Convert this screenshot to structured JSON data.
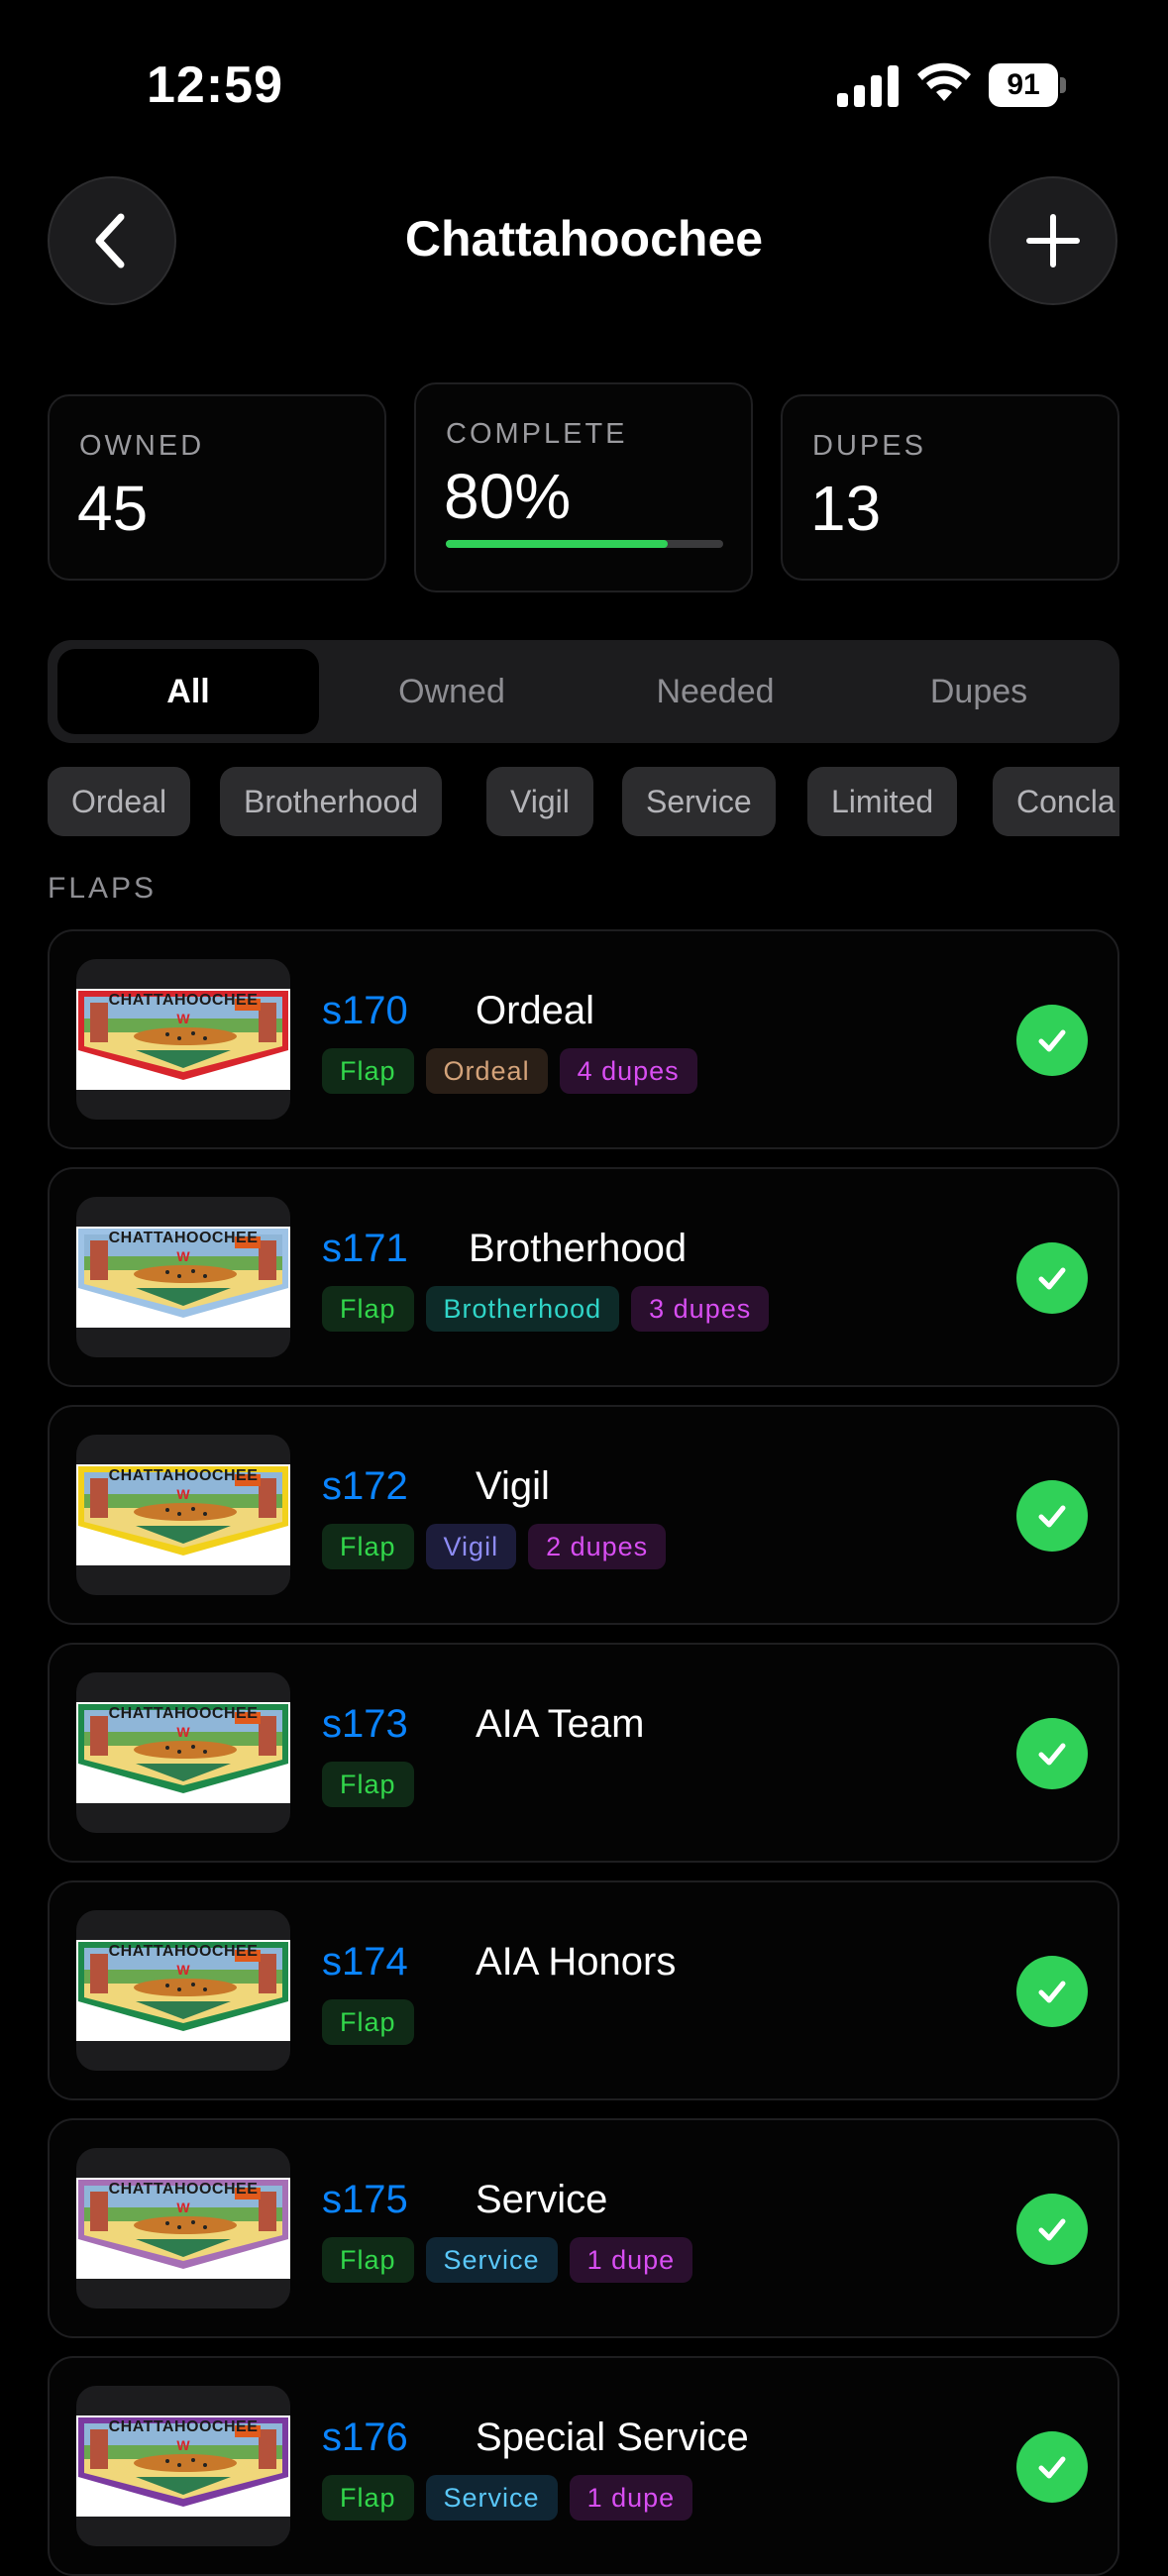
{
  "status": {
    "time": "12:59",
    "battery": "91"
  },
  "header": {
    "title": "Chattahoochee"
  },
  "stats": {
    "owned": {
      "label": "OWNED",
      "value": "45"
    },
    "complete": {
      "label": "COMPLETE",
      "value": "80%",
      "progress": 0.8
    },
    "dupes": {
      "label": "DUPES",
      "value": "13"
    }
  },
  "segments": [
    "All",
    "Owned",
    "Needed",
    "Dupes"
  ],
  "active_segment": "All",
  "filters": [
    "Ordeal",
    "Brotherhood",
    "Vigil",
    "Service",
    "Limited",
    "Concla"
  ],
  "section": "FLAPS",
  "items": [
    {
      "code": "s170",
      "name": "Ordeal",
      "tags": [
        {
          "text": "Flap",
          "kind": "flap"
        },
        {
          "text": "Ordeal",
          "kind": "ordeal"
        },
        {
          "text": "4 dupes",
          "kind": "dupes"
        }
      ],
      "border_color": "#d8252c"
    },
    {
      "code": "s171",
      "name": "Brotherhood",
      "tags": [
        {
          "text": "Flap",
          "kind": "flap"
        },
        {
          "text": "Brotherhood",
          "kind": "brotherhood"
        },
        {
          "text": "3 dupes",
          "kind": "dupes"
        }
      ],
      "border_color": "#9ec3e6"
    },
    {
      "code": "s172",
      "name": "Vigil",
      "tags": [
        {
          "text": "Flap",
          "kind": "flap"
        },
        {
          "text": "Vigil",
          "kind": "vigil"
        },
        {
          "text": "2 dupes",
          "kind": "dupes"
        }
      ],
      "border_color": "#f2d11a"
    },
    {
      "code": "s173",
      "name": "AIA Team",
      "tags": [
        {
          "text": "Flap",
          "kind": "flap"
        }
      ],
      "border_color": "#1e8a4a"
    },
    {
      "code": "s174",
      "name": "AIA Honors",
      "tags": [
        {
          "text": "Flap",
          "kind": "flap"
        }
      ],
      "border_color": "#1e8a4a"
    },
    {
      "code": "s175",
      "name": "Service",
      "tags": [
        {
          "text": "Flap",
          "kind": "flap"
        },
        {
          "text": "Service",
          "kind": "service"
        },
        {
          "text": "1 dupe",
          "kind": "dupes"
        }
      ],
      "border_color": "#a66fb5"
    },
    {
      "code": "s176",
      "name": "Special Service",
      "tags": [
        {
          "text": "Flap",
          "kind": "flap"
        },
        {
          "text": "Service",
          "kind": "service"
        },
        {
          "text": "1 dupe",
          "kind": "dupes"
        }
      ],
      "border_color": "#7b3aa0"
    }
  ],
  "patch_text": "CHATTAHOOCHEE",
  "patch_emblem": "W"
}
